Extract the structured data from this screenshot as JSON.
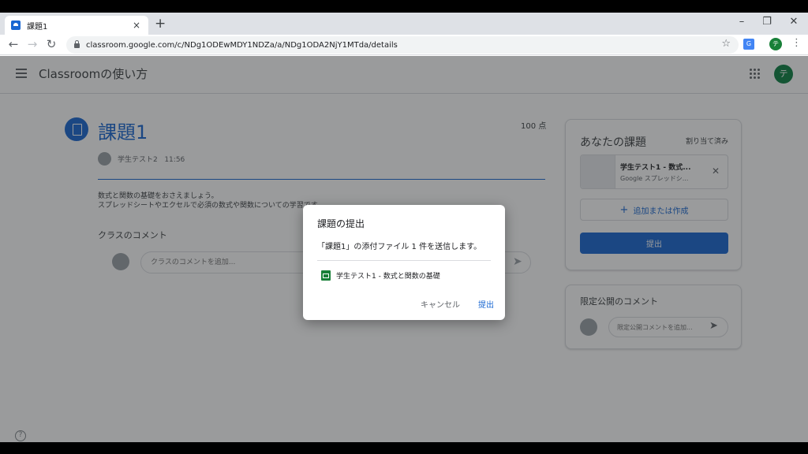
{
  "browser": {
    "tab_title": "課題1",
    "close_glyph": "×",
    "new_tab_glyph": "+",
    "url": "classroom.google.com/c/NDg1ODEwMDY1NDZa/a/NDg1ODA2NjY1MTda/details",
    "profile_initial": "テ",
    "window_controls": [
      "–",
      "❐",
      "✕"
    ]
  },
  "app": {
    "title": "Classroomの使い方",
    "user_initial": "テ",
    "accent": "#1967d2"
  },
  "assignment": {
    "title": "課題1",
    "points": "100 点",
    "author": "学生テスト2",
    "time": "11:56",
    "description_line1": "数式と関数の基礎をおさえましょう。",
    "description_line2": "スプレッドシートやエクセルで必須の数式や関数についての学習です。",
    "class_comments_label": "クラスのコメント",
    "class_comment_placeholder": "クラスのコメントを追加..."
  },
  "your_work": {
    "title": "あなたの課題",
    "status": "割り当て済み",
    "attachment_name": "学生テスト1 - 数式...",
    "attachment_type": "Google スプレッドシ...",
    "add_or_create": "追加または作成",
    "submit": "提出"
  },
  "private_comments": {
    "title": "限定公開のコメント",
    "placeholder": "限定公開コメントを追加..."
  },
  "dialog": {
    "title": "課題の提出",
    "message": "「課題1」の添付ファイル 1 件を送信します。",
    "file": "学生テスト1 - 数式と関数の基礎",
    "cancel": "キャンセル",
    "submit": "提出"
  },
  "icons": {
    "back": "←",
    "forward": "→",
    "reload": "↻",
    "star": "☆",
    "menu": "⋮",
    "remove": "✕",
    "plus": "+",
    "send": "➤",
    "help": "?"
  }
}
